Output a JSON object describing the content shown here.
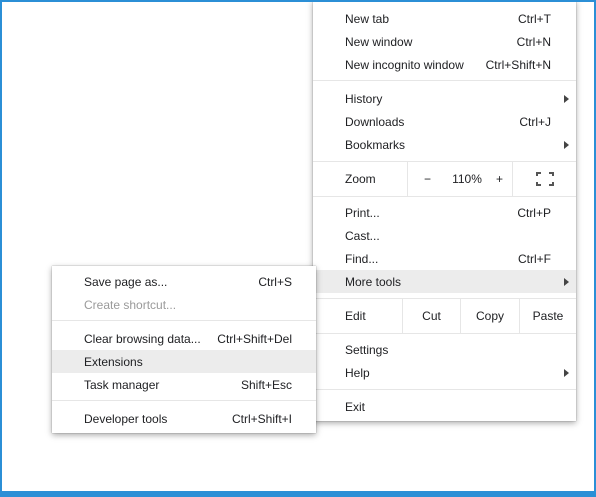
{
  "main_menu": {
    "new_tab": {
      "label": "New tab",
      "shortcut": "Ctrl+T"
    },
    "new_window": {
      "label": "New window",
      "shortcut": "Ctrl+N"
    },
    "new_incognito": {
      "label": "New incognito window",
      "shortcut": "Ctrl+Shift+N"
    },
    "history": {
      "label": "History"
    },
    "downloads": {
      "label": "Downloads",
      "shortcut": "Ctrl+J"
    },
    "bookmarks": {
      "label": "Bookmarks"
    },
    "zoom": {
      "label": "Zoom",
      "minus": "−",
      "level": "110%",
      "plus": "+",
      "fullscreen_icon": "fullscreen-icon"
    },
    "print": {
      "label": "Print...",
      "shortcut": "Ctrl+P"
    },
    "cast": {
      "label": "Cast..."
    },
    "find": {
      "label": "Find...",
      "shortcut": "Ctrl+F"
    },
    "more_tools": {
      "label": "More tools"
    },
    "edit": {
      "label": "Edit",
      "cut": "Cut",
      "copy": "Copy",
      "paste": "Paste"
    },
    "settings": {
      "label": "Settings"
    },
    "help": {
      "label": "Help"
    },
    "exit": {
      "label": "Exit"
    }
  },
  "sub_menu": {
    "save_page": {
      "label": "Save page as...",
      "shortcut": "Ctrl+S"
    },
    "create_shortcut": {
      "label": "Create shortcut..."
    },
    "clear_browsing": {
      "label": "Clear browsing data...",
      "shortcut": "Ctrl+Shift+Del"
    },
    "extensions": {
      "label": "Extensions"
    },
    "task_manager": {
      "label": "Task manager",
      "shortcut": "Shift+Esc"
    },
    "developer_tools": {
      "label": "Developer tools",
      "shortcut": "Ctrl+Shift+I"
    }
  },
  "colors": {
    "highlight": "#ececec",
    "frame": "#2b8fd6",
    "disabled_text": "#9a9a9a"
  }
}
